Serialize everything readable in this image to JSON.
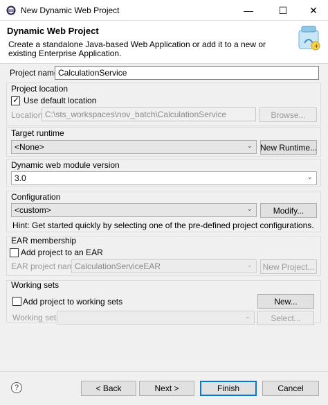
{
  "window": {
    "title": "New Dynamic Web Project"
  },
  "header": {
    "title": "Dynamic Web Project",
    "description": "Create a standalone Java-based Web Application or add it to a new or existing Enterprise Application."
  },
  "project_name": {
    "label": "Project name:",
    "value": "CalculationService"
  },
  "project_location": {
    "group_label": "Project location",
    "use_default_label": "Use default location",
    "use_default_checked": true,
    "location_label": "Location:",
    "location_value": "C:\\sts_workspaces\\nov_batch\\CalculationService",
    "browse_label": "Browse..."
  },
  "target_runtime": {
    "label": "Target runtime",
    "value": "<None>",
    "new_runtime_label": "New Runtime..."
  },
  "module_version": {
    "label": "Dynamic web module version",
    "value": "3.0"
  },
  "configuration": {
    "label": "Configuration",
    "value": "<custom>",
    "modify_label": "Modify...",
    "hint": "Hint: Get started quickly by selecting one of the pre-defined project configurations."
  },
  "ear": {
    "group_label": "EAR membership",
    "add_label": "Add project to an EAR",
    "add_checked": false,
    "project_name_label": "EAR project name:",
    "project_name_value": "CalculationServiceEAR",
    "new_project_label": "New Project..."
  },
  "working_sets": {
    "group_label": "Working sets",
    "add_label": "Add project to working sets",
    "add_checked": false,
    "new_label": "New...",
    "sets_label": "Working sets:",
    "sets_value": "",
    "select_label": "Select..."
  },
  "footer": {
    "back_label": "< Back",
    "next_label": "Next >",
    "finish_label": "Finish",
    "cancel_label": "Cancel"
  },
  "colors": {
    "accent": "#0078d7",
    "background": "#f0f0f0"
  }
}
